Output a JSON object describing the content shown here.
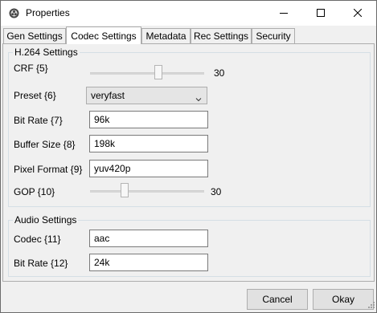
{
  "window": {
    "title": "Properties",
    "app_icon": "obs-icon"
  },
  "titlebar_buttons": {
    "minimize": "minimize-icon",
    "maximize": "maximize-icon",
    "close": "close-icon"
  },
  "tabs": [
    {
      "label": "Gen Settings",
      "active": false
    },
    {
      "label": "Codec Settings",
      "active": true
    },
    {
      "label": "Metadata",
      "active": false
    },
    {
      "label": "Rec Settings",
      "active": false
    },
    {
      "label": "Security",
      "active": false
    }
  ],
  "h264": {
    "title": "H.264 Settings",
    "crf": {
      "label": "CRF {5}",
      "value": "30"
    },
    "preset": {
      "label": "Preset {6}",
      "value": "veryfast"
    },
    "bitrate": {
      "label": "Bit Rate {7}",
      "value": "96k"
    },
    "buffer": {
      "label": "Buffer Size {8}",
      "value": "198k"
    },
    "pixfmt": {
      "label": "Pixel Format {9}",
      "value": "yuv420p"
    },
    "gop": {
      "label": "GOP {10}",
      "value": "30"
    }
  },
  "audio": {
    "title": "Audio Settings",
    "codec": {
      "label": "Codec {11}",
      "value": "aac"
    },
    "bitrate": {
      "label": "Bit Rate {12}",
      "value": "24k"
    }
  },
  "buttons": {
    "cancel": "Cancel",
    "okay": "Okay"
  }
}
